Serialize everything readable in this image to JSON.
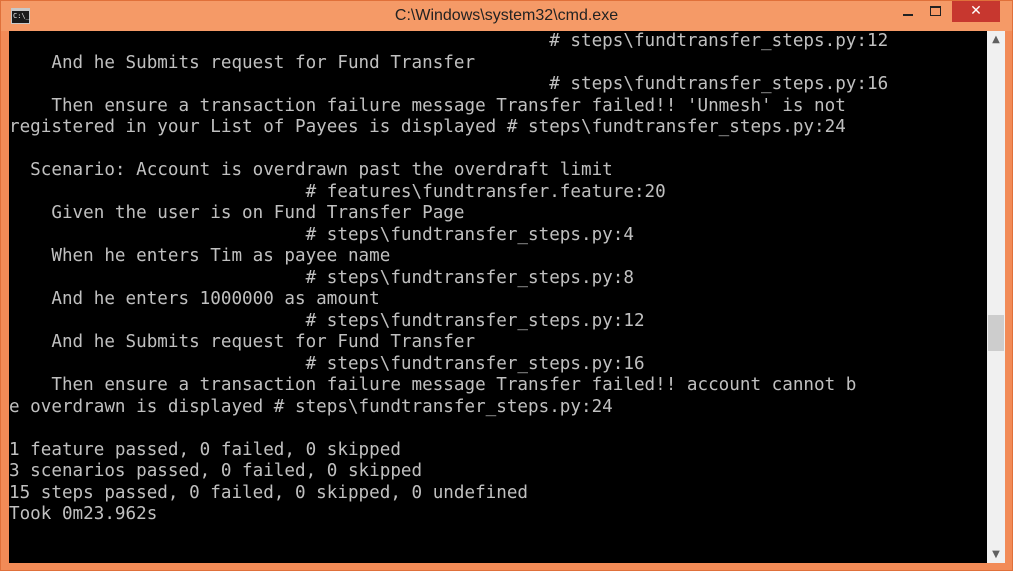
{
  "window": {
    "title": "C:\\Windows\\system32\\cmd.exe",
    "app_icon_label": "C:\\_",
    "close_glyph": "✕"
  },
  "console": {
    "lines": [
      "                                                   # steps\\fundtransfer_steps.py:12",
      "    And he Submits request for Fund Transfer",
      "                                                   # steps\\fundtransfer_steps.py:16",
      "    Then ensure a transaction failure message Transfer failed!! 'Unmesh' is not",
      "registered in your List of Payees is displayed # steps\\fundtransfer_steps.py:24",
      "",
      "  Scenario: Account is overdrawn past the overdraft limit",
      "                            # features\\fundtransfer.feature:20",
      "    Given the user is on Fund Transfer Page",
      "                            # steps\\fundtransfer_steps.py:4",
      "    When he enters Tim as payee name",
      "                            # steps\\fundtransfer_steps.py:8",
      "    And he enters 1000000 as amount",
      "                            # steps\\fundtransfer_steps.py:12",
      "    And he Submits request for Fund Transfer",
      "                            # steps\\fundtransfer_steps.py:16",
      "    Then ensure a transaction failure message Transfer failed!! account cannot b",
      "e overdrawn is displayed # steps\\fundtransfer_steps.py:24",
      "",
      "1 feature passed, 0 failed, 0 skipped",
      "3 scenarios passed, 0 failed, 0 skipped",
      "15 steps passed, 0 failed, 0 skipped, 0 undefined",
      "Took 0m23.962s"
    ]
  },
  "colors": {
    "title_bar": "#f59a67",
    "close_button": "#c7372f",
    "console_bg": "#000000",
    "console_fg": "#c0c0c0"
  },
  "icons": {
    "app": "cmd-icon",
    "minimize": "minimize-icon",
    "maximize": "maximize-icon",
    "close": "close-icon",
    "scroll_up": "scroll-up-arrow-icon",
    "scroll_down": "scroll-down-arrow-icon"
  }
}
